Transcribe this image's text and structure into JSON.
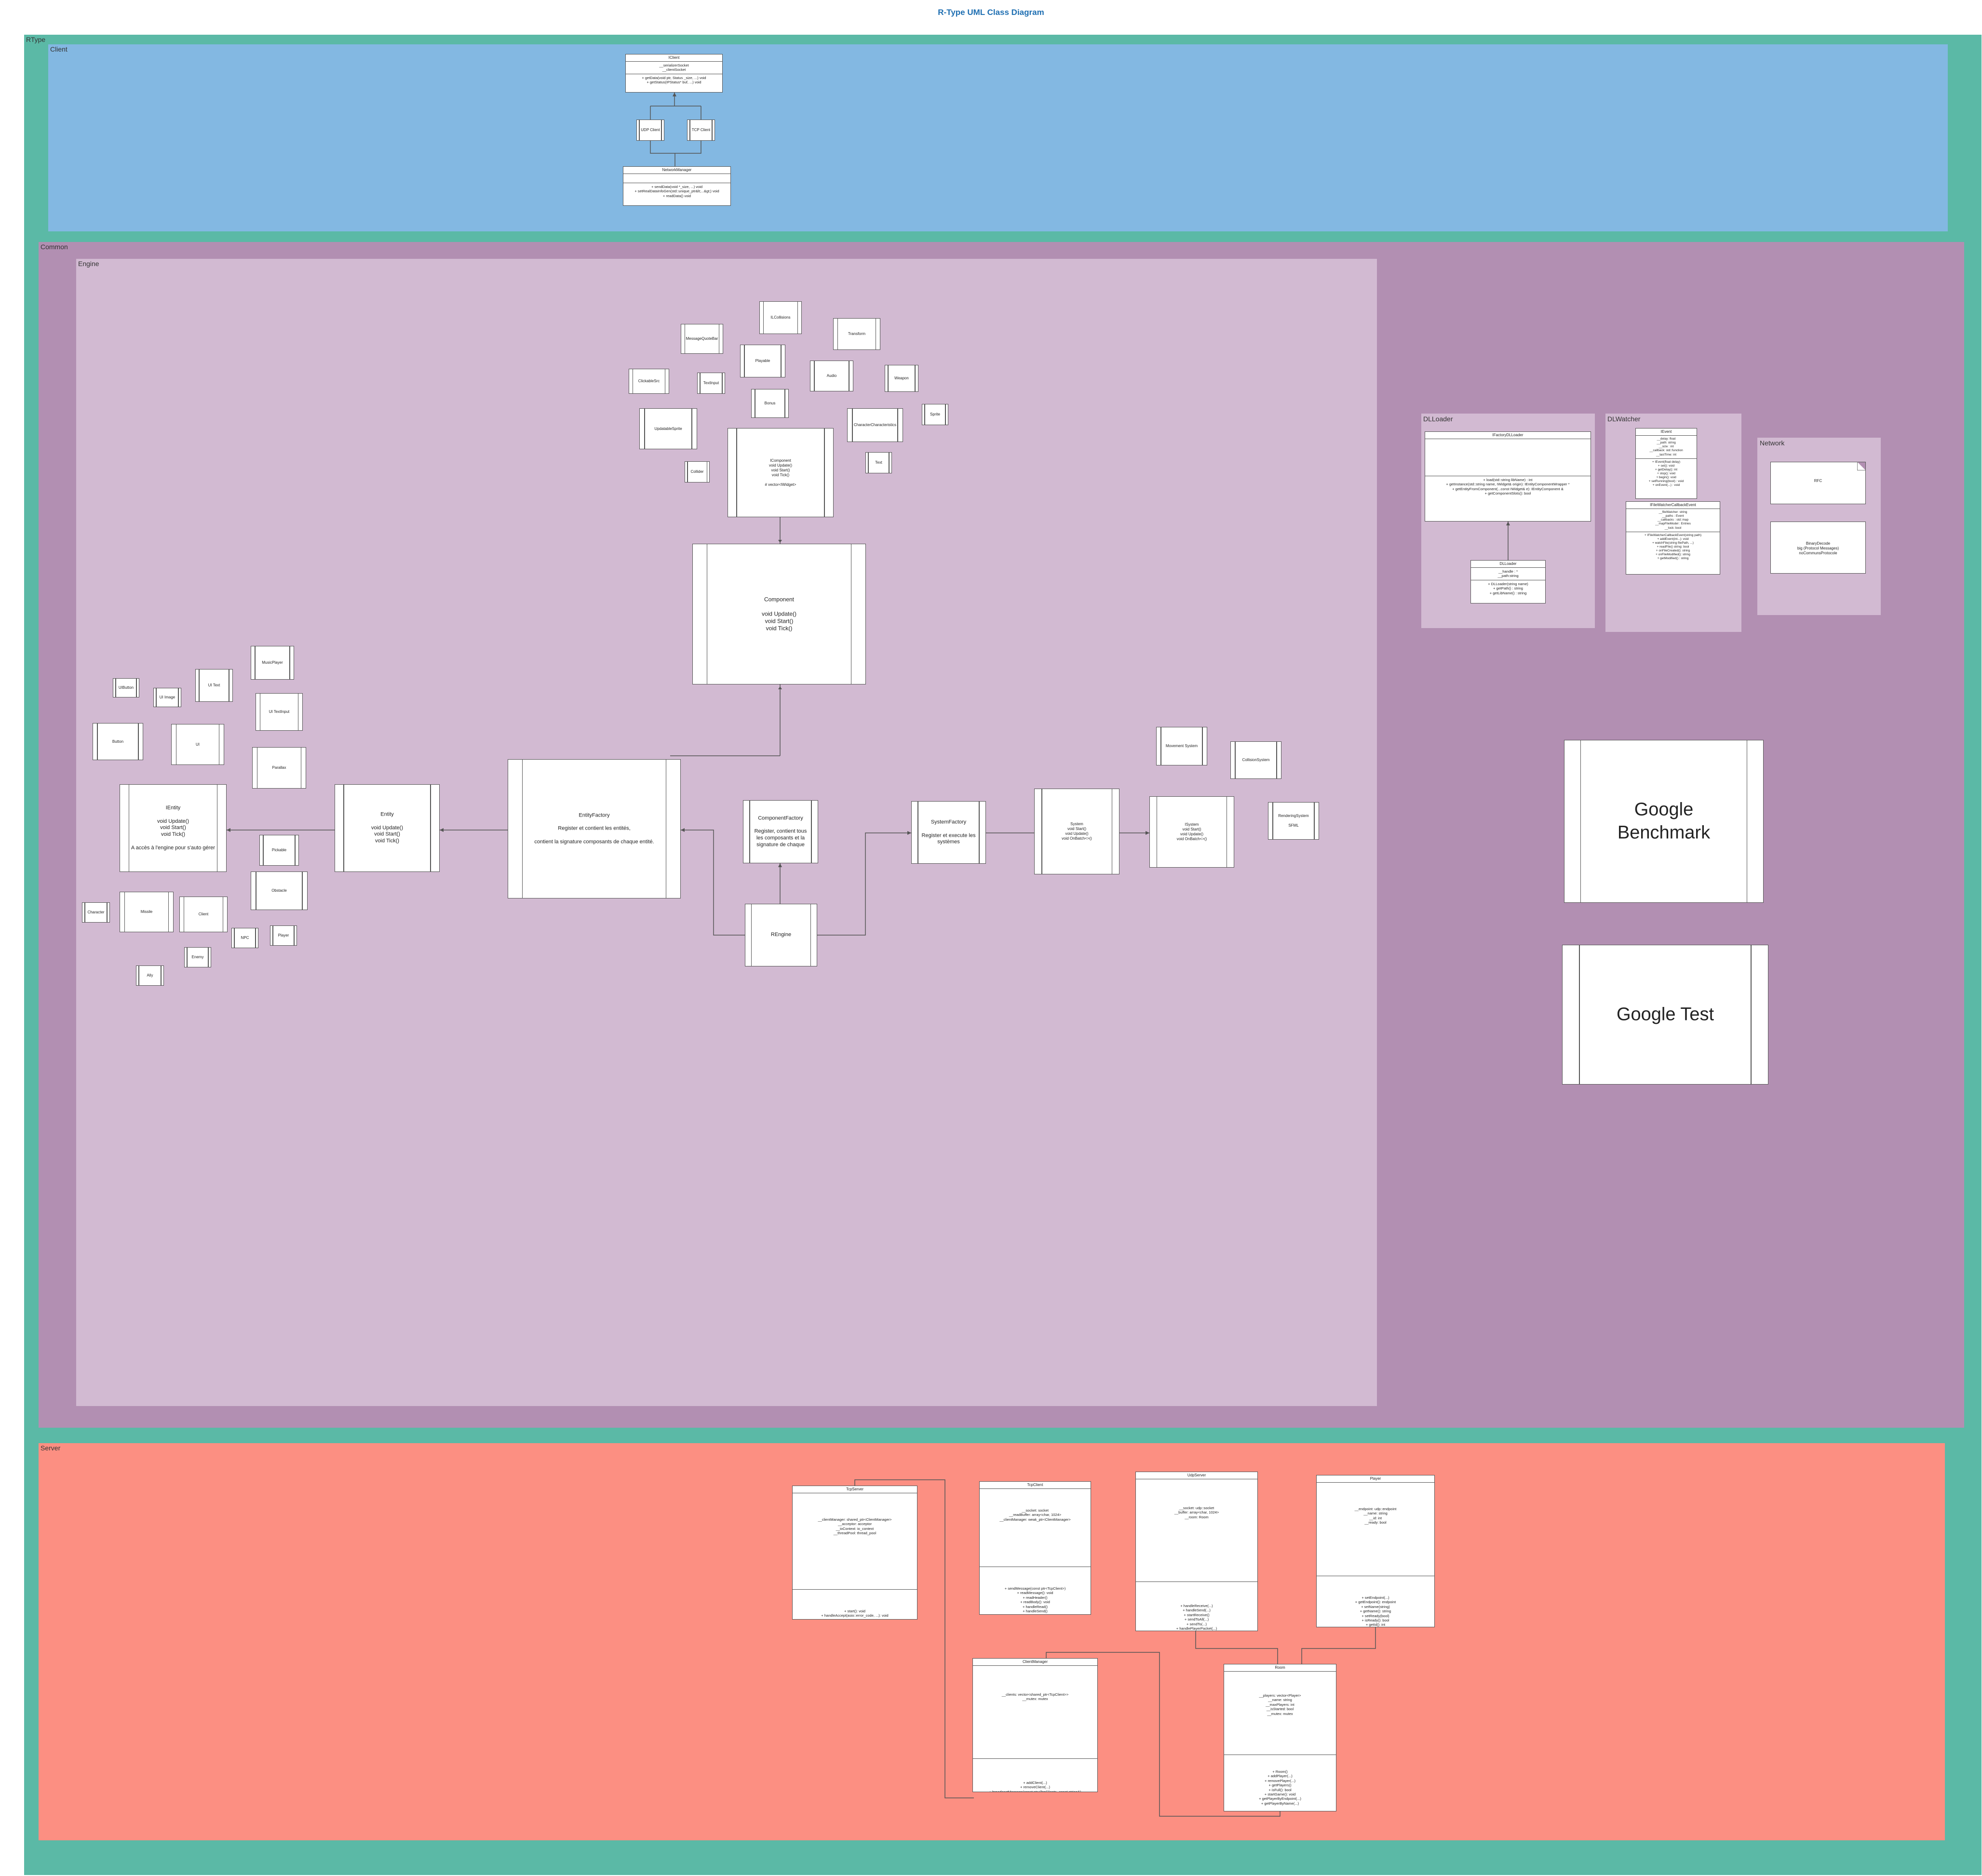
{
  "diagram": {
    "title": "R-Type UML Class Diagram",
    "colors": {
      "rtype": "#5bb9a6",
      "client": "#83b8e2",
      "common": "#b28fb2",
      "engine": "#d2bad2",
      "sub": "#d2bad2",
      "server": "#fc8f82"
    },
    "regions": {
      "rtype": "RType",
      "client": "Client",
      "common": "Common",
      "engine": "Engine",
      "dlloader": "DLLoader",
      "dlwatcher": "DLWatcher",
      "network": "Network",
      "server": "Server"
    },
    "client": {
      "iclient": {
        "title": "IClient",
        "attrs": "__serializerSocket\n__clientSocket",
        "methods": "+ getData(void ptr, Status _size, ...) void\n+ getStatus(IPStatus* buf, ...) void"
      },
      "udp": "UDP Client",
      "tcp": "TCP Client",
      "manager": {
        "title": "NetworkManager",
        "attrs": "",
        "methods": "+ sendData(void *_size, ...) void\n+ setRealDataInfoGen(std::unique_ptr&lt;...&gt;) void\n+ readData() void"
      }
    },
    "engine": {
      "cloud": {
        "collisions": "ILCollisions",
        "message": "MessageQuoteBar",
        "transform": "Transform",
        "playable": "Playable",
        "clickable": "ClickableSrc",
        "textinput": "TextInput",
        "audio": "Audio",
        "weapon": "Weapon",
        "sprite": "Sprite",
        "bonus": "Bonus",
        "character": "CharacterCharacteristics",
        "updatable": "UpdatableSprite",
        "icomponent": "IComponent\nvoid Update()\nvoid Start()\nvoid Tick()\n\n# vector<IWidget>",
        "collider": "Collider",
        "text": "Text"
      },
      "component": "Component\n\nvoid Update()\nvoid Start()\nvoid Tick()",
      "entities": {
        "uibutton": "UIButton",
        "uiimage": "UI Image",
        "uitext": "UI Text",
        "musicplayer": "MusicPlayer",
        "uitextinput": "UI TextInput",
        "button": "Button",
        "ui": "UI",
        "parallax": "Parallax",
        "ientity": "IEntity\n\nvoid Update()\nvoid Start()\nvoid Tick()\n\nA accès à l'engine pour s'auto gérer",
        "entity": "Entity\n\nvoid Update()\nvoid Start()\nvoid Tick()",
        "pickable": "Pickable",
        "obstacle": "Obstacle",
        "character": "Character",
        "missile": "Missile",
        "client": "Client",
        "npc": "NPC",
        "player": "Player",
        "enemy": "Enemy",
        "ally": "Ally"
      },
      "entityfactory": "EntityFactory\n\nRegister et contient les entités,\n\ncontient la signature composants de chaque entité.",
      "componentfactory": "ComponentFactory\n\nRegister, contient tous les composants et la signature de chaque",
      "rengine": "REngine",
      "systemfactory": "SystemFactory\n\nRegister et execute les systèmes",
      "system": "System\nvoid Start()\nvoid Update()\nvoid OnBatch<>()",
      "isystem": "ISystem\nvoid Start()\nvoid Update()\nvoid OnBatch<>()",
      "movement": "Movement System",
      "collision": "CollisionSystem",
      "rendering": "RenderingSystem\n\nSFML"
    },
    "dlloader": {
      "ifactory": {
        "title": "IFactoryDLLoader",
        "attrs": "",
        "methods": "+ load(std::string libName) : int\n+ getInstance(std::string name, IWidget& origin): IEntityComponentWrapper *\n+ getEntityFromComponent(...const IWidget& e): IEntityComponent &\n+ getComponentSlots(): bool"
      },
      "dlloader": {
        "title": "DLLoader",
        "attrs": "__handle : *\n__path:string",
        "methods": "+ DLLoader(string name)\n+ getPath() : string\n+ getLibName() : string"
      }
    },
    "dlwatcher": {
      "ievent": {
        "title": "IEvent",
        "attrs": "__delay: float\n__path: string\n__size : int\n__callback: std::function\n__lastTime: int",
        "methods": "+ IEvent(float delay)\n+ set(): void\n+ getDelay(): int\n+ stop(): void\n+ begin(): void\n+ setRunning(bool) : void\n+ onEvent(...) : void"
      },
      "ifwatcher": {
        "title": "IFileWatcherCallbackEvent",
        "attrs": "__fileWatcher: string\n__paths : Event\n__callbacks : std::map\n__mapFileModel : Entries\n__lock: bool",
        "methods": "+ IFileWatcherCallbackEvent(string path)\n+ addEvent(int...): void\n+ watchFile(string filePath, ...)\n+ readFile() string: bool\n+ onFileCreated(): string\n+ onFileModified(): string\n+ getModified() : string"
      }
    },
    "network": {
      "doc1": "RFC",
      "doc2": "BinaryDecode\nbig (Protocol Messages)\nnoCommunsProtocole"
    },
    "external": {
      "bench": "Google\nBenchmark",
      "gtest": "Google Test"
    },
    "server": {
      "tcpserver": {
        "title": "TcpServer",
        "attrs": "__clientManager: shared_ptr<ClientManager>\n__acceptor: acceptor\n__ioContext: io_context\n__threadPool: thread_pool",
        "methods": "+ start(): void\n+ handleAccept(asio::error_code, ...): void"
      },
      "tcpclient": {
        "title": "TcpClient",
        "attrs": "__socket: socket\n__readBuffer: array<char, 1024>\n__clientManager: weak_ptr<ClientManager>",
        "methods": "+ sendMessage(const ptr<TcpClient>)\n+ readMessage(): void\n+ readHeader()\n+ readBody(): void\n+ handleRead()\n+ handleSend()"
      },
      "udpserver": {
        "title": "UdpServer",
        "attrs": "__socket: udp::socket\n__buffer: array<char, 1024>\n__room: Room",
        "methods": "+ handleReceive(...)\n+ handleSend(...)\n+ startReceive()\n+ sendToAll(...)\n+ sendTo(...)\n+ handlePlayerPacket(...)"
      },
      "player": {
        "title": "Player",
        "attrs": "__endpoint: udp::endpoint\n__name: string\n__id: int\n__ready: bool",
        "methods": "+ setEndpoint(...)\n+ getEndpoint(): endpoint\n+ setName(string)\n+ getName(): string\n+ setReady(bool)\n+ isReady(): bool\n+ getId(): int"
      },
      "clientmanager": {
        "title": "ClientManager",
        "attrs": "__clients: vector<shared_ptr<TcpClient>>\n__mutex: mutex",
        "methods": "+ addClient(...)\n+ removeClient(...)\n+ broadcastMessage(const ptr<TcpClient>, const string&)\n+ getClientByName(...)"
      },
      "room": {
        "title": "Room",
        "attrs": "__players: vector<Player>\n__name: string\n__maxPlayers: int\n__isStarted: bool\n__mutex: mutex",
        "methods": "+ Room()\n+ addPlayer(...)\n+ removePlayer(...)\n+ getPlayers()\n+ isFull(): bool\n+ startGame(): void\n+ getPlayerByEndpoint(...)\n+ getPlayerByName(...)"
      }
    }
  }
}
